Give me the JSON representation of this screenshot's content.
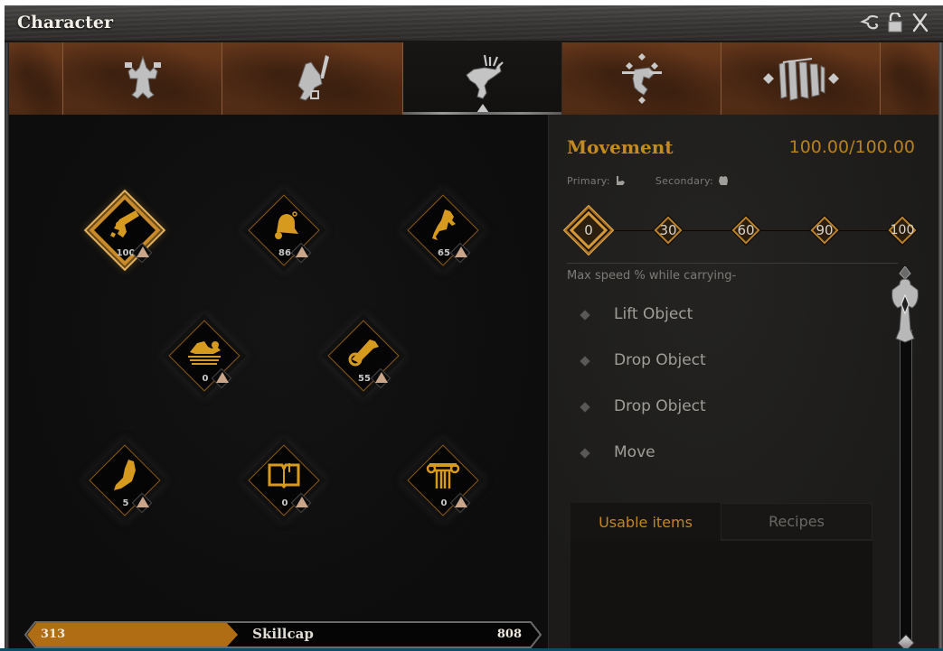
{
  "window": {
    "title": "Character",
    "controls": [
      {
        "name": "pin-icon",
        "label": "Pin"
      },
      {
        "name": "unlock-icon",
        "label": "Lock"
      },
      {
        "name": "close-icon",
        "label": "Close"
      }
    ]
  },
  "category_tabs": [
    {
      "name": "tab-crafting",
      "icon": "craftsman-glyph-icon",
      "active": false
    },
    {
      "name": "tab-combat",
      "icon": "warrior-glyph-icon",
      "active": false
    },
    {
      "name": "tab-survival",
      "icon": "hunter-glyph-icon",
      "active": true
    },
    {
      "name": "tab-magic",
      "icon": "mystic-glyph-icon",
      "active": false
    },
    {
      "name": "tab-social",
      "icon": "group-glyph-icon",
      "active": false
    }
  ],
  "skills": [
    {
      "name": "movement",
      "icon": "carrying-log-icon",
      "level": "100",
      "selected": true
    },
    {
      "name": "bell",
      "icon": "bell-icon",
      "level": "86",
      "selected": false
    },
    {
      "name": "riding",
      "icon": "horse-icon",
      "level": "65",
      "selected": false
    },
    {
      "name": "swimming",
      "icon": "swimmer-icon",
      "level": "0",
      "selected": false
    },
    {
      "name": "scroll",
      "icon": "scroll-icon",
      "level": "55",
      "selected": false
    },
    {
      "name": "prayer",
      "icon": "praying-hands-icon",
      "level": "5",
      "selected": false
    },
    {
      "name": "lore",
      "icon": "open-book-icon",
      "level": "0",
      "selected": false
    },
    {
      "name": "architecture",
      "icon": "column-icon",
      "level": "0",
      "selected": false
    }
  ],
  "skillcap": {
    "label": "Skillcap",
    "current": "313",
    "max": "808",
    "fill_fraction": 0.387
  },
  "detail": {
    "title": "Movement",
    "progress": "100.00/100.00",
    "primary_label": "Primary:",
    "primary_icon": "flexed-arm-icon",
    "secondary_label": "Secondary:",
    "secondary_icon": "fist-icon",
    "milestones": [
      "0",
      "30",
      "60",
      "90",
      "100"
    ],
    "current_milestone": "0",
    "perk_description": "Max speed % while carrying-",
    "perks": [
      "Lift Object",
      "Drop Object",
      "Drop Object",
      "Move"
    ],
    "item_tabs": [
      {
        "label": "Usable items",
        "active": true
      },
      {
        "label": "Recipes",
        "active": false
      }
    ]
  },
  "colors": {
    "accent_gold": "#c48a24",
    "progress_orange": "#b8801e",
    "tab_wood": "#5c3118"
  }
}
